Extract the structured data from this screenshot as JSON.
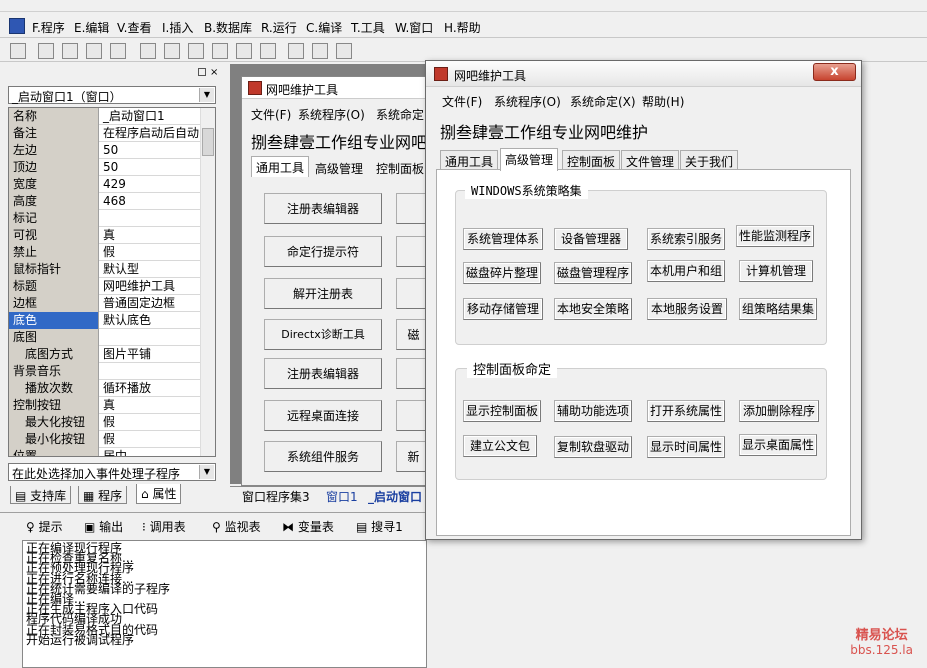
{
  "menubar": {
    "items": [
      "F.程序",
      "E.编辑",
      "V.查看",
      "I.插入",
      "B.数据库",
      "R.运行",
      "C.编译",
      "T.工具",
      "W.窗口",
      "H.帮助"
    ]
  },
  "prop_panel": {
    "object_select": "_启动窗口1（窗口）",
    "rows": [
      {
        "k": "名称",
        "v": "_启动窗口1"
      },
      {
        "k": "备注",
        "v": "在程序启动后自动"
      },
      {
        "k": "左边",
        "v": "50"
      },
      {
        "k": "顶边",
        "v": "50"
      },
      {
        "k": "宽度",
        "v": "429"
      },
      {
        "k": "高度",
        "v": "468"
      },
      {
        "k": "标记",
        "v": ""
      },
      {
        "k": "可视",
        "v": "真"
      },
      {
        "k": "禁止",
        "v": "假"
      },
      {
        "k": "鼠标指针",
        "v": "默认型"
      },
      {
        "k": "标题",
        "v": "网吧维护工具"
      },
      {
        "k": "边框",
        "v": "普通固定边框"
      },
      {
        "k": "底色",
        "v": "默认底色"
      },
      {
        "k": "底图",
        "v": ""
      },
      {
        "k": "底图方式",
        "v": "图片平铺"
      },
      {
        "k": "背景音乐",
        "v": ""
      },
      {
        "k": "播放次数",
        "v": "循环播放"
      },
      {
        "k": "控制按钮",
        "v": "真"
      },
      {
        "k": "最大化按钮",
        "v": "假"
      },
      {
        "k": "最小化按钮",
        "v": "假"
      },
      {
        "k": "位置",
        "v": "居中"
      }
    ],
    "event_select": "在此处选择加入事件处理子程序",
    "tabs": [
      "支持库",
      "程序",
      "属性"
    ]
  },
  "design_window": {
    "title": "网吧维护工具",
    "menu": [
      "文件(F)",
      "系统程序(O)",
      "系统命定"
    ],
    "heading": "捌叁肆壹工作组专业网吧",
    "tabs": [
      "通用工具",
      "高级管理",
      "控制面板"
    ],
    "buttons": [
      "注册表编辑器",
      "命定行提示符",
      "解开注册表",
      "Directx诊断工具",
      "注册表编辑器",
      "远程桌面连接",
      "系统组件服务"
    ],
    "right_labels": [
      "",
      "",
      "",
      "磁",
      "",
      "",
      "新"
    ]
  },
  "doc_tabs": [
    "窗口程序集3",
    "窗口1",
    "_启动窗口"
  ],
  "output": {
    "tabs": [
      "提示",
      "输出",
      "调用表",
      "监视表",
      "变量表",
      "搜寻1"
    ],
    "lines": [
      "正在编译现行程序",
      "正在检查重复名称...",
      "正在预处理现行程序",
      "正在进行名称连接...",
      "正在统计需要编译的子程序",
      "正在编译...",
      "正在生成主程序入口代码",
      "程序代码编译成功",
      "正在封装易格式目的代码",
      "开始运行被调试程序"
    ]
  },
  "dialog": {
    "title": "网吧维护工具",
    "close": "x",
    "menu": [
      "文件(F)",
      "系统程序(O)",
      "系统命定(X)",
      "帮助(H)"
    ],
    "heading": "捌叁肆壹工作组专业网吧维护",
    "tabs": [
      "通用工具",
      "高级管理",
      "控制面板",
      "文件管理",
      "关于我们"
    ],
    "group1": {
      "title": "WINDOWS系统策略集",
      "buttons": [
        "系统管理体系",
        "设备管理器",
        "系统索引服务",
        "性能监测程序",
        "磁盘碎片整理",
        "磁盘管理程序",
        "本机用户和组",
        "计算机管理",
        "移动存储管理",
        "本地安全策略",
        "本地服务设置",
        "组策略结果集"
      ]
    },
    "group2": {
      "title": "控制面板命定",
      "buttons": [
        "显示控制面板",
        "辅助功能选项",
        "打开系统属性",
        "添加删除程序",
        "建立公文包",
        "复制软盘驱动",
        "显示时间属性",
        "显示桌面属性"
      ]
    }
  },
  "watermark": {
    "line1": "精易论坛",
    "line2": "bbs.125.la"
  }
}
